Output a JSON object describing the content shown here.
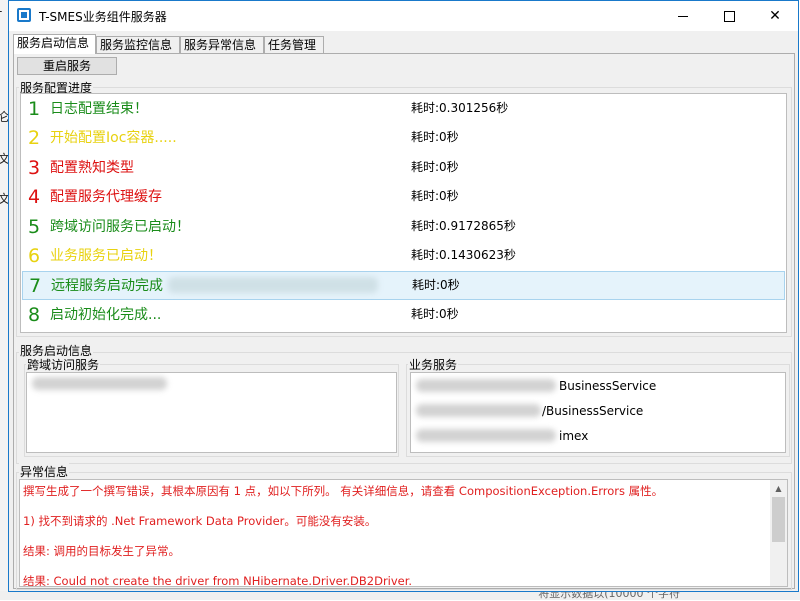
{
  "background": {
    "left_glyphs": [
      "-",
      "仑",
      "文",
      "文"
    ],
    "bottom_text": "将显示数据以(10000 个字符"
  },
  "window": {
    "title": "T-SMES业务组件服务器",
    "controls": {
      "minimize": "minimize",
      "maximize": "maximize",
      "close": "✕"
    }
  },
  "tabs": [
    {
      "label": "服务启动信息",
      "active": true
    },
    {
      "label": "服务监控信息",
      "active": false
    },
    {
      "label": "服务异常信息",
      "active": false
    },
    {
      "label": "任务管理",
      "active": false
    }
  ],
  "restart_button": "重启服务",
  "progress": {
    "group_label": "服务配置进度",
    "steps": [
      {
        "num": "1",
        "text": "日志配置结束！",
        "time": "耗时:0.301256秒",
        "color": "#1a8c1a"
      },
      {
        "num": "2",
        "text": "开始配置Ioc容器.....",
        "time": "耗时:0秒",
        "color": "#e8d210"
      },
      {
        "num": "3",
        "text": "配置熟知类型",
        "time": "耗时:0秒",
        "color": "#dd1111"
      },
      {
        "num": "4",
        "text": "配置服务代理缓存",
        "time": "耗时:0秒",
        "color": "#dd1111"
      },
      {
        "num": "5",
        "text": "跨域访问服务已启动！",
        "time": "耗时:0.9172865秒",
        "color": "#1a8c1a"
      },
      {
        "num": "6",
        "text": "业务服务已启动！",
        "time": "耗时:0.1430623秒",
        "color": "#e8d210"
      },
      {
        "num": "7",
        "text": "远程服务启动完成",
        "time": "耗时:0秒",
        "color": "#1a8c1a",
        "selected": true
      },
      {
        "num": "8",
        "text": "启动初始化完成...",
        "time": "耗时:0秒",
        "color": "#1a8c1a"
      }
    ]
  },
  "startup_info": {
    "group_label": "服务启动信息",
    "cross_domain": {
      "label": "跨域访问服务"
    },
    "business": {
      "label": "业务服务",
      "items": [
        "BusinessService",
        "/BusinessService",
        "imex"
      ]
    }
  },
  "exceptions": {
    "group_label": "异常信息",
    "lines": [
      "撰写生成了一个撰写错误，其根本原因有 1 点，如以下所列。 有关详细信息，请查看 CompositionException.Errors 属性。",
      "1) 找不到请求的 .Net Framework Data Provider。可能没有安装。",
      "结果: 调用的目标发生了异常。",
      "结果: Could not create the driver from NHibernate.Driver.DB2Driver."
    ],
    "error_color": "#e02020"
  }
}
